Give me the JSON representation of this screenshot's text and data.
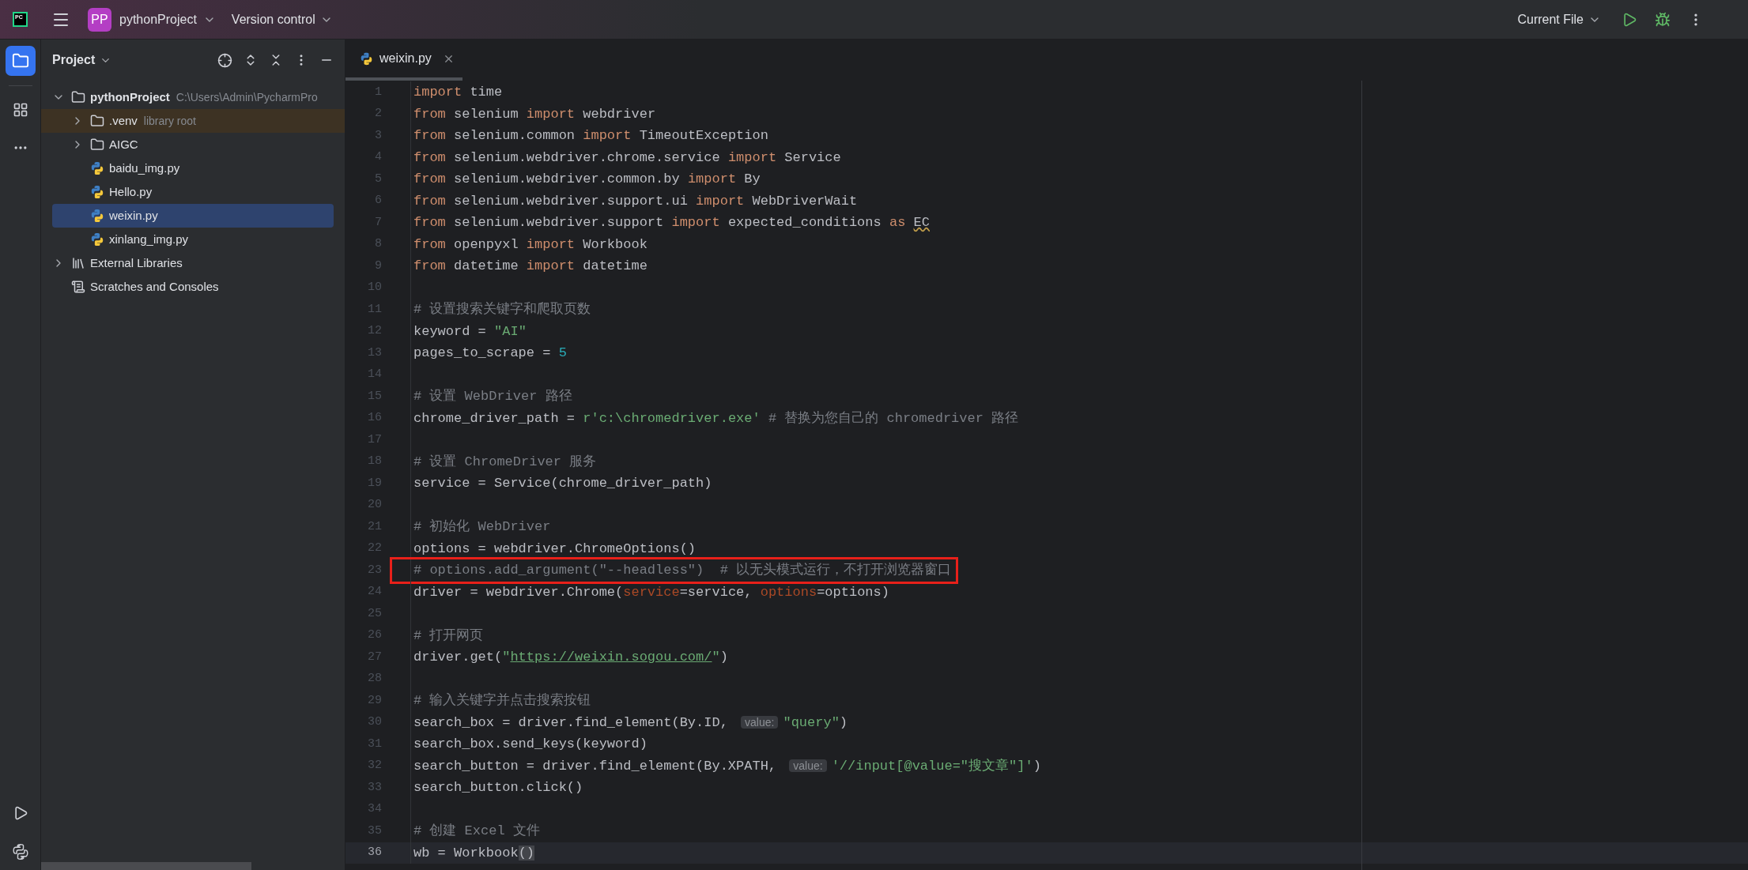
{
  "title_bar": {
    "logo": "PC",
    "project_badge": "PP",
    "project": "pythonProject",
    "vcs": "Version control",
    "run_config": "Current File"
  },
  "project_panel": {
    "title": "Project",
    "tree": [
      {
        "label": "pythonProject",
        "kind": "project",
        "hint": "C:\\Users\\Admin\\PycharmPro",
        "expanded": true,
        "selected": false,
        "children": [
          {
            "label": ".venv",
            "kind": "library-folder",
            "hint": "library root",
            "expanded": false,
            "selected": false
          },
          {
            "label": "AIGC",
            "kind": "folder",
            "expanded": false,
            "selected": false
          },
          {
            "label": "baidu_img.py",
            "kind": "python",
            "selected": false
          },
          {
            "label": "Hello.py",
            "kind": "python",
            "selected": false
          },
          {
            "label": "weixin.py",
            "kind": "python",
            "selected": true
          },
          {
            "label": "xinlang_img.py",
            "kind": "python",
            "selected": false
          }
        ]
      },
      {
        "label": "External Libraries",
        "kind": "libraries",
        "expanded": false,
        "selected": false
      },
      {
        "label": "Scratches and Consoles",
        "kind": "scratches",
        "selected": false
      }
    ]
  },
  "editor": {
    "tabs": [
      {
        "label": "weixin.py",
        "selected": true
      }
    ],
    "lines": [
      {
        "number": "1",
        "tokens": [
          {
            "kind": "kw",
            "text": "import"
          },
          {
            "kind": "id",
            "text": " time"
          }
        ]
      },
      {
        "number": "2",
        "tokens": [
          {
            "kind": "kw",
            "text": "from"
          },
          {
            "kind": "id",
            "text": " selenium "
          },
          {
            "kind": "kw",
            "text": "import"
          },
          {
            "kind": "id",
            "text": " webdriver"
          }
        ]
      },
      {
        "number": "3",
        "tokens": [
          {
            "kind": "kw",
            "text": "from"
          },
          {
            "kind": "id",
            "text": " selenium.common "
          },
          {
            "kind": "kw",
            "text": "import"
          },
          {
            "kind": "id",
            "text": " TimeoutException"
          }
        ]
      },
      {
        "number": "4",
        "tokens": [
          {
            "kind": "kw",
            "text": "from"
          },
          {
            "kind": "id",
            "text": " selenium.webdriver.chrome.service "
          },
          {
            "kind": "kw",
            "text": "import"
          },
          {
            "kind": "id",
            "text": " Service"
          }
        ]
      },
      {
        "number": "5",
        "tokens": [
          {
            "kind": "kw",
            "text": "from"
          },
          {
            "kind": "id",
            "text": " selenium.webdriver.common.by "
          },
          {
            "kind": "kw",
            "text": "import"
          },
          {
            "kind": "id",
            "text": " By"
          }
        ]
      },
      {
        "number": "6",
        "tokens": [
          {
            "kind": "kw",
            "text": "from"
          },
          {
            "kind": "id",
            "text": " selenium.webdriver.support.ui "
          },
          {
            "kind": "kw",
            "text": "import"
          },
          {
            "kind": "id",
            "text": " WebDriverWait"
          }
        ]
      },
      {
        "number": "7",
        "tokens": [
          {
            "kind": "kw",
            "text": "from"
          },
          {
            "kind": "id",
            "text": " selenium.webdriver.support "
          },
          {
            "kind": "kw",
            "text": "import"
          },
          {
            "kind": "id",
            "text": " expected_conditions "
          },
          {
            "kind": "kw",
            "text": "as "
          },
          {
            "kind": "warn",
            "text": "EC"
          }
        ]
      },
      {
        "number": "8",
        "tokens": [
          {
            "kind": "kw",
            "text": "from"
          },
          {
            "kind": "id",
            "text": " openpyxl "
          },
          {
            "kind": "kw",
            "text": "import"
          },
          {
            "kind": "id",
            "text": " Workbook"
          }
        ]
      },
      {
        "number": "9",
        "tokens": [
          {
            "kind": "kw",
            "text": "from"
          },
          {
            "kind": "id",
            "text": " datetime "
          },
          {
            "kind": "kw",
            "text": "import"
          },
          {
            "kind": "id",
            "text": " datetime"
          }
        ]
      },
      {
        "number": "10"
      },
      {
        "number": "11",
        "tokens": [
          {
            "kind": "comment",
            "text": "# 设置搜索关键字和爬取页数"
          }
        ]
      },
      {
        "number": "12",
        "tokens": [
          {
            "kind": "id",
            "text": "keyword = "
          },
          {
            "kind": "str",
            "text": "\"AI\""
          }
        ]
      },
      {
        "number": "13",
        "tokens": [
          {
            "kind": "id",
            "text": "pages_to_scrape = "
          },
          {
            "kind": "num",
            "text": "5"
          }
        ]
      },
      {
        "number": "14"
      },
      {
        "number": "15",
        "tokens": [
          {
            "kind": "comment",
            "text": "# 设置 WebDriver 路径"
          }
        ]
      },
      {
        "number": "16",
        "tokens": [
          {
            "kind": "id",
            "text": "chrome_driver_path = "
          },
          {
            "kind": "str",
            "text": "r'c:\\chromedriver.exe'"
          },
          {
            "kind": "comment",
            "text": " # 替换为您自己的 chromedriver 路径"
          }
        ]
      },
      {
        "number": "17"
      },
      {
        "number": "18",
        "tokens": [
          {
            "kind": "comment",
            "text": "# 设置 ChromeDriver 服务"
          }
        ]
      },
      {
        "number": "19",
        "tokens": [
          {
            "kind": "id",
            "text": "service = Service(chrome_driver_path)"
          }
        ]
      },
      {
        "number": "20"
      },
      {
        "number": "21",
        "tokens": [
          {
            "kind": "comment",
            "text": "# 初始化 WebDriver"
          }
        ]
      },
      {
        "number": "22",
        "tokens": [
          {
            "kind": "id",
            "text": "options = webdriver.ChromeOptions()"
          }
        ]
      },
      {
        "number": "23",
        "highlighted": true,
        "tokens": [
          {
            "kind": "comment",
            "text": "# options.add_argument(\"--headless\")  # 以无头模式运行，不打开浏览器窗口"
          }
        ]
      },
      {
        "number": "24",
        "tokens": [
          {
            "kind": "id",
            "text": "driver = webdriver.Chrome("
          },
          {
            "kind": "param",
            "text": "service"
          },
          {
            "kind": "id",
            "text": "=service, "
          },
          {
            "kind": "param",
            "text": "options"
          },
          {
            "kind": "id",
            "text": "=options)"
          }
        ]
      },
      {
        "number": "25"
      },
      {
        "number": "26",
        "tokens": [
          {
            "kind": "comment",
            "text": "# 打开网页"
          }
        ]
      },
      {
        "number": "27",
        "tokens": [
          {
            "kind": "id",
            "text": "driver.get("
          },
          {
            "kind": "str",
            "text": "\""
          },
          {
            "kind": "url",
            "text": "https://weixin.sogou.com/"
          },
          {
            "kind": "str",
            "text": "\""
          },
          {
            "kind": "id",
            "text": ")"
          }
        ]
      },
      {
        "number": "28"
      },
      {
        "number": "29",
        "tokens": [
          {
            "kind": "comment",
            "text": "# 输入关键字并点击搜索按钮"
          }
        ]
      },
      {
        "number": "30",
        "tokens": [
          {
            "kind": "id",
            "text": "search_box = driver.find_element(By.ID, "
          },
          {
            "kind": "hint",
            "text": "value:"
          },
          {
            "kind": "str",
            "text": "\"query\""
          },
          {
            "kind": "id",
            "text": ")"
          }
        ]
      },
      {
        "number": "31",
        "tokens": [
          {
            "kind": "id",
            "text": "search_box.send_keys(keyword)"
          }
        ]
      },
      {
        "number": "32",
        "tokens": [
          {
            "kind": "id",
            "text": "search_button = driver.find_element(By.XPATH, "
          },
          {
            "kind": "hint",
            "text": "value:"
          },
          {
            "kind": "str",
            "text": "'//input[@value=\"搜文章\"]'"
          },
          {
            "kind": "id",
            "text": ")"
          }
        ]
      },
      {
        "number": "33",
        "tokens": [
          {
            "kind": "id",
            "text": "search_button.click()"
          }
        ]
      },
      {
        "number": "34"
      },
      {
        "number": "35",
        "tokens": [
          {
            "kind": "comment",
            "text": "# 创建 Excel 文件"
          }
        ]
      },
      {
        "number": "36",
        "current": true,
        "tokens": [
          {
            "kind": "id",
            "text": "wb = Workbook"
          },
          {
            "kind": "bracket",
            "text": "()"
          }
        ]
      }
    ]
  }
}
